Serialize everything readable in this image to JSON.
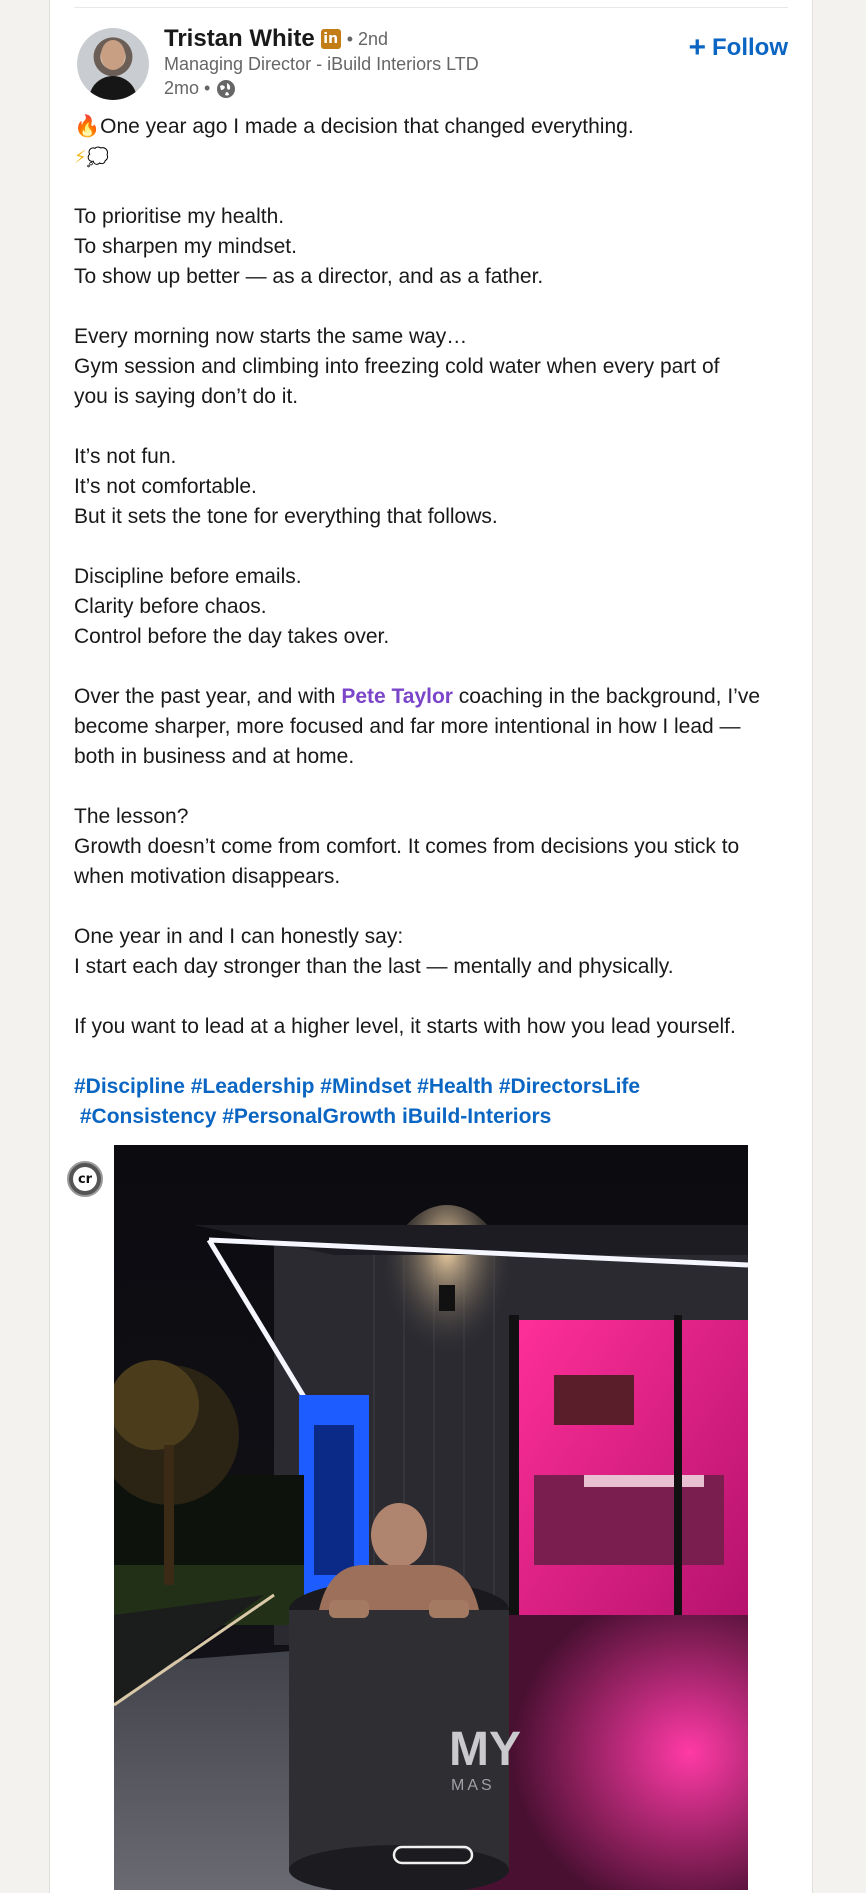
{
  "author": {
    "name": "Tristan White",
    "badge": "in",
    "degree": "• 2nd",
    "headline": "Managing Director - iBuild Interiors LTD",
    "time": "2mo •",
    "visibility_icon": "globe-icon"
  },
  "follow": {
    "icon": "+",
    "label": "Follow"
  },
  "post": {
    "line1_emoji": "🔥",
    "line1": "One year ago I made a decision that changed everything.",
    "line2_emoji_a": "⚡",
    "line2_emoji_b": "💭",
    "para1": [
      "To prioritise my health.",
      "To sharpen my mindset.",
      "To show up better — as a director, and as a father."
    ],
    "para2": [
      "Every morning now starts the same way…",
      "Gym session and climbing into freezing cold water when every part of",
      "you is saying don’t do it."
    ],
    "para3": [
      "It’s not fun.",
      "It’s not comfortable.",
      "But it sets the tone for everything that follows."
    ],
    "para4": [
      "Discipline before emails.",
      "Clarity before chaos.",
      "Control before the day takes over."
    ],
    "para5_prefix": "Over the past year, and with ",
    "para5_mention": "Pete Taylor",
    "para5_suffix": " coaching in the background, I’ve",
    "para5_rest": [
      "become sharper, more focused and far more intentional in how I lead —",
      "both in business and at home."
    ],
    "para6": [
      "The lesson?",
      "Growth doesn’t come from comfort. It comes from decisions you stick to",
      "when motivation disappears."
    ],
    "para7": [
      "One year in and I can honestly say:",
      "I start each day stronger than the last — mentally and physically."
    ],
    "para8": "If you want to lead at a higher level, it starts with how you lead yourself.",
    "hashtags_line1": [
      "#Discipline",
      "#Leadership",
      "#Mindset",
      "#Health",
      "#DirectorsLife"
    ],
    "hashtags_line2": [
      "#Consistency",
      "#PersonalGrowth",
      "iBuild-Interiors"
    ]
  },
  "image": {
    "cr_badge": "cr",
    "tub_text_big": "MY",
    "tub_text_small": "MAS"
  },
  "colors": {
    "link_blue": "#0a66c2",
    "mention_purple": "#7a45c8",
    "badge_gold": "#c37d16"
  }
}
